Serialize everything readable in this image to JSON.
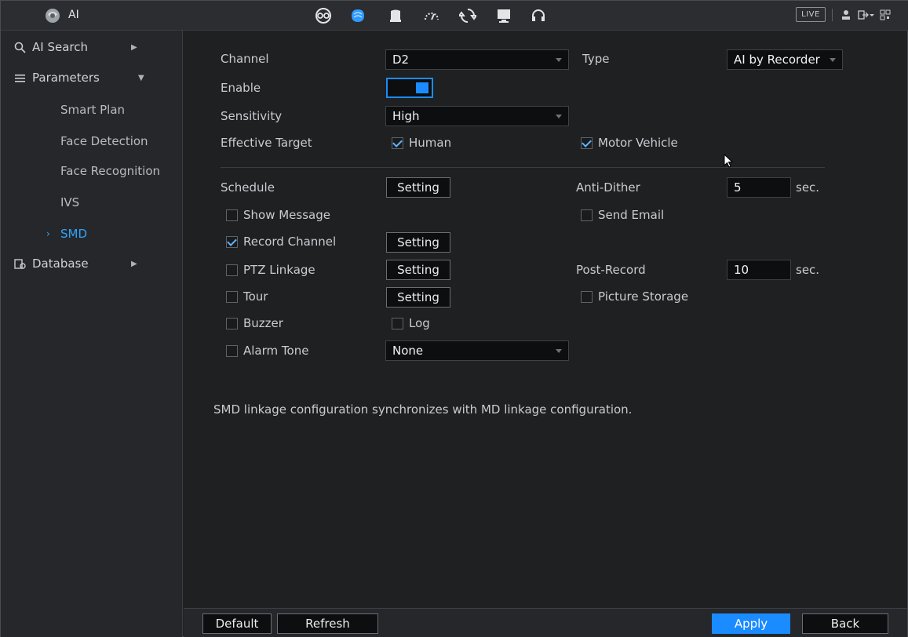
{
  "header": {
    "app_title": "AI",
    "live_label": "LIVE",
    "nav_icons": [
      "ai-search-icon",
      "ai-brain-icon",
      "storage-icon",
      "performance-icon",
      "maintenance-icon",
      "display-icon",
      "headset-icon"
    ],
    "active_icon": "ai-brain-icon",
    "accent_color": "#1a8cff"
  },
  "sidebar": {
    "items": [
      {
        "label": "AI Search",
        "icon": "ai-search-icon"
      },
      {
        "label": "Parameters",
        "icon": "list-icon"
      },
      {
        "label": "Database",
        "icon": "database-icon"
      }
    ],
    "sub_items": [
      {
        "label": "Smart Plan"
      },
      {
        "label": "Face Detection"
      },
      {
        "label": "Face Recognition"
      },
      {
        "label": "IVS"
      },
      {
        "label": "SMD",
        "active": true
      }
    ]
  },
  "form": {
    "channel_label": "Channel",
    "channel_value": "D2",
    "type_label": "Type",
    "type_value": "AI by Recorder",
    "enable_label": "Enable",
    "enable_on": true,
    "sensitivity_label": "Sensitivity",
    "sensitivity_value": "High",
    "effective_target_label": "Effective Target",
    "human_label": "Human",
    "human_checked": true,
    "motor_vehicle_label": "Motor Vehicle",
    "motor_vehicle_checked": true,
    "schedule_label": "Schedule",
    "setting_label": "Setting",
    "anti_dither_label": "Anti-Dither",
    "anti_dither_value": "5",
    "sec_label": "sec.",
    "show_message_label": "Show Message",
    "send_email_label": "Send Email",
    "record_channel_label": "Record Channel",
    "ptz_linkage_label": "PTZ Linkage",
    "post_record_label": "Post-Record",
    "post_record_value": "10",
    "tour_label": "Tour",
    "picture_storage_label": "Picture Storage",
    "buzzer_label": "Buzzer",
    "log_label": "Log",
    "alarm_tone_label": "Alarm Tone",
    "alarm_tone_value": "None",
    "note": "SMD linkage configuration synchronizes with MD linkage configuration."
  },
  "footer": {
    "default_label": "Default",
    "refresh_label": "Refresh",
    "apply_label": "Apply",
    "back_label": "Back"
  }
}
